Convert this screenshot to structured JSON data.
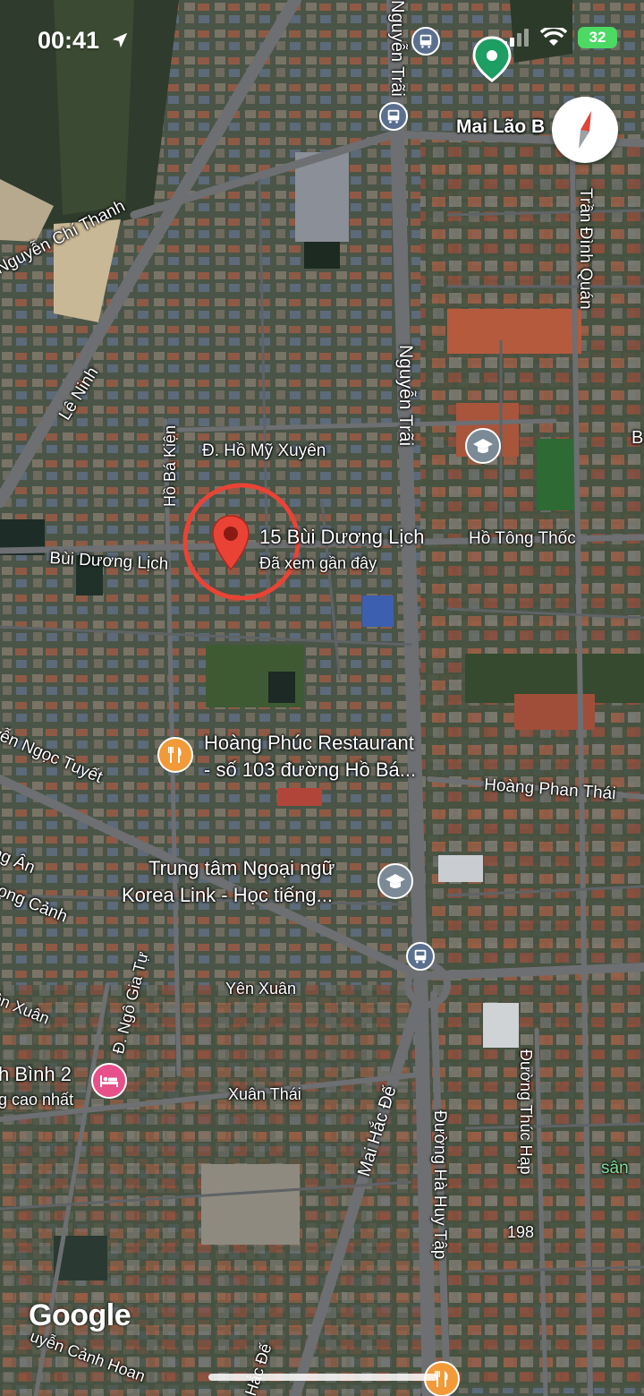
{
  "status_bar": {
    "time": "00:41",
    "battery": "32"
  },
  "selected_place": {
    "name": "15 Bùi Dương Lịch",
    "subtitle": "Đã xem gần đây"
  },
  "streets": {
    "nguyen_trai": "Nguyễn Trãi",
    "mai_lao_bang": "Mai Lão B",
    "tran_dinh_quan": "Trần Đình Quán",
    "nguyen_chi_thanh": "Nguyễn Chí Thanh",
    "le_ninh": "Lê Ninh",
    "ho_ba_kien": "Hồ Bá Kiện",
    "ho_my_xuyen": "Đ. Hồ Mỹ Xuyên",
    "bui_duong_lich": "Bùi Dương Lịch",
    "ho_tong_thoc": "Hồ Tông Thốc",
    "nguyen_ngoc_tuyet": "yễn Ngọc Tuyết",
    "hoang_phan_thai": "Hoàng Phan Thái",
    "ong_an": "ng Ân",
    "trong_canh": "rọng Cảnh",
    "yen_xuan": "Yên Xuân",
    "en_xuan": "ên Xuân",
    "ngo_gia_tu": "Đ. Ngô Gia Tự",
    "xuan_thai": "Xuân Thái",
    "mai_hac_de": "Mai Hắc Đế",
    "ha_huy_tap": "Đường Hà Huy Tập",
    "thuc_hap": "Đường Thúc Hạp",
    "number_198": "198",
    "san": "sân",
    "nguyen_canh_hoan": "uyễn Cảnh Hoan",
    "hac_de_bottom": "Hắc Đế",
    "b_edge": "B"
  },
  "pois": {
    "restaurant_line1": "Hoàng Phúc Restaurant",
    "restaurant_line2": "- số 103 đường Hồ Bá...",
    "school_line1": "Trung tâm Ngoại ngữ",
    "school_line2": "Korea Link - Học tiếng...",
    "hotel_line1": "h Bình 2",
    "hotel_line2": "g cao nhất"
  },
  "logo": "Google",
  "colors": {
    "pin_red": "#ea4335",
    "restaurant_orange": "#f29a38",
    "school_gray": "#7b8a96",
    "hotel_pink": "#e8508a",
    "transit_blue": "#5b6f8f",
    "compass_red": "#e0453a"
  }
}
